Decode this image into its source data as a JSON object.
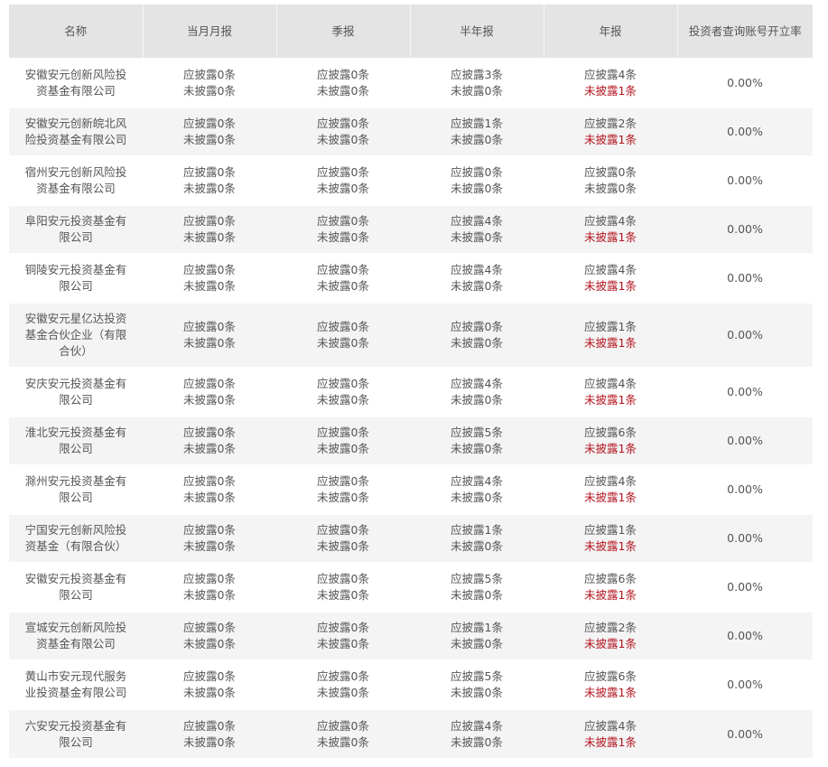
{
  "colors": {
    "header_bg": "#e4e4e4",
    "stripe_bg": "#f4f4f4",
    "alert_red": "#b3141f",
    "text": "#555555"
  },
  "headers": {
    "name": "名称",
    "monthly": "当月月报",
    "quarterly": "季报",
    "half_year": "半年报",
    "annual": "年报",
    "rate": "投资者查询账号开立率"
  },
  "rows": [
    {
      "name": "安徽安元创新风险投资基金有限公司",
      "m": [
        "应披露0条",
        "未披露0条"
      ],
      "q": [
        "应披露0条",
        "未披露0条"
      ],
      "h": [
        "应披露3条",
        "未披露0条"
      ],
      "a": [
        "应披露4条",
        "未披露1条"
      ],
      "rate": "0.00%"
    },
    {
      "name": "安徽安元创新皖北风险投资基金有限公司",
      "m": [
        "应披露0条",
        "未披露0条"
      ],
      "q": [
        "应披露0条",
        "未披露0条"
      ],
      "h": [
        "应披露1条",
        "未披露0条"
      ],
      "a": [
        "应披露2条",
        "未披露1条"
      ],
      "rate": "0.00%"
    },
    {
      "name": "宿州安元创新风险投资基金有限公司",
      "m": [
        "应披露0条",
        "未披露0条"
      ],
      "q": [
        "应披露0条",
        "未披露0条"
      ],
      "h": [
        "应披露0条",
        "未披露0条"
      ],
      "a": [
        "应披露0条",
        "未披露0条"
      ],
      "rate": "0.00%"
    },
    {
      "name": "阜阳安元投资基金有限公司",
      "m": [
        "应披露0条",
        "未披露0条"
      ],
      "q": [
        "应披露0条",
        "未披露0条"
      ],
      "h": [
        "应披露4条",
        "未披露0条"
      ],
      "a": [
        "应披露4条",
        "未披露1条"
      ],
      "rate": "0.00%"
    },
    {
      "name": "铜陵安元投资基金有限公司",
      "m": [
        "应披露0条",
        "未披露0条"
      ],
      "q": [
        "应披露0条",
        "未披露0条"
      ],
      "h": [
        "应披露4条",
        "未披露0条"
      ],
      "a": [
        "应披露4条",
        "未披露1条"
      ],
      "rate": "0.00%"
    },
    {
      "name": "安徽安元星亿达投资基金合伙企业（有限合伙）",
      "m": [
        "应披露0条",
        "未披露0条"
      ],
      "q": [
        "应披露0条",
        "未披露0条"
      ],
      "h": [
        "应披露0条",
        "未披露0条"
      ],
      "a": [
        "应披露1条",
        "未披露1条"
      ],
      "rate": "0.00%"
    },
    {
      "name": "安庆安元投资基金有限公司",
      "m": [
        "应披露0条",
        "未披露0条"
      ],
      "q": [
        "应披露0条",
        "未披露0条"
      ],
      "h": [
        "应披露4条",
        "未披露0条"
      ],
      "a": [
        "应披露4条",
        "未披露1条"
      ],
      "rate": "0.00%"
    },
    {
      "name": "淮北安元投资基金有限公司",
      "m": [
        "应披露0条",
        "未披露0条"
      ],
      "q": [
        "应披露0条",
        "未披露0条"
      ],
      "h": [
        "应披露5条",
        "未披露0条"
      ],
      "a": [
        "应披露6条",
        "未披露1条"
      ],
      "rate": "0.00%"
    },
    {
      "name": "滁州安元投资基金有限公司",
      "m": [
        "应披露0条",
        "未披露0条"
      ],
      "q": [
        "应披露0条",
        "未披露0条"
      ],
      "h": [
        "应披露4条",
        "未披露0条"
      ],
      "a": [
        "应披露4条",
        "未披露1条"
      ],
      "rate": "0.00%"
    },
    {
      "name": "宁国安元创新风险投资基金（有限合伙）",
      "m": [
        "应披露0条",
        "未披露0条"
      ],
      "q": [
        "应披露0条",
        "未披露0条"
      ],
      "h": [
        "应披露1条",
        "未披露0条"
      ],
      "a": [
        "应披露1条",
        "未披露1条"
      ],
      "rate": "0.00%"
    },
    {
      "name": "安徽安元投资基金有限公司",
      "m": [
        "应披露0条",
        "未披露0条"
      ],
      "q": [
        "应披露0条",
        "未披露0条"
      ],
      "h": [
        "应披露5条",
        "未披露0条"
      ],
      "a": [
        "应披露6条",
        "未披露1条"
      ],
      "rate": "0.00%"
    },
    {
      "name": "宣城安元创新风险投资基金有限公司",
      "m": [
        "应披露0条",
        "未披露0条"
      ],
      "q": [
        "应披露0条",
        "未披露0条"
      ],
      "h": [
        "应披露1条",
        "未披露0条"
      ],
      "a": [
        "应披露2条",
        "未披露1条"
      ],
      "rate": "0.00%"
    },
    {
      "name": "黄山市安元现代服务业投资基金有限公司",
      "m": [
        "应披露0条",
        "未披露0条"
      ],
      "q": [
        "应披露0条",
        "未披露0条"
      ],
      "h": [
        "应披露5条",
        "未披露0条"
      ],
      "a": [
        "应披露6条",
        "未披露1条"
      ],
      "rate": "0.00%"
    },
    {
      "name": "六安安元投资基金有限公司",
      "m": [
        "应披露0条",
        "未披露0条"
      ],
      "q": [
        "应披露0条",
        "未披露0条"
      ],
      "h": [
        "应披露4条",
        "未披露0条"
      ],
      "a": [
        "应披露4条",
        "未披露1条"
      ],
      "rate": "0.00%"
    }
  ]
}
